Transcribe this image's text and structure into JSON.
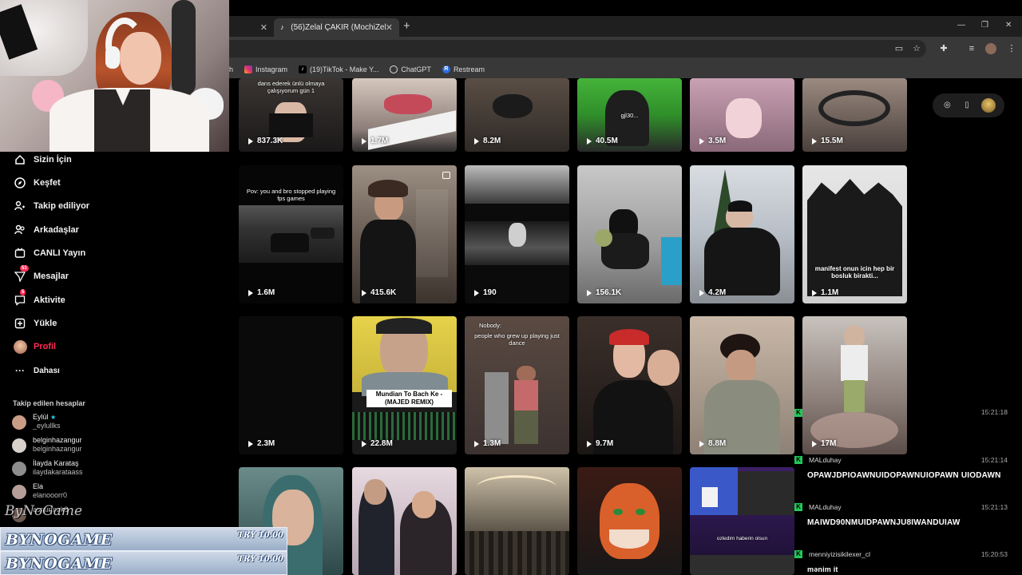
{
  "browser": {
    "tabs": [
      {
        "title": "(56)Zelal ÇAKIR (MochiZel) (@...",
        "active": true
      }
    ],
    "new_tab_label": "+",
    "bookmarks": [
      {
        "label": "h",
        "icon": "generic"
      },
      {
        "label": "Instagram",
        "icon": "instagram-icon"
      },
      {
        "label": "(19)TikTok - Make Y...",
        "icon": "tiktok-icon"
      },
      {
        "label": "ChatGPT",
        "icon": "chatgpt-icon"
      },
      {
        "label": "Restream",
        "icon": "restream-icon"
      }
    ]
  },
  "sidebar": {
    "nav": [
      {
        "label": "Sizin İçin",
        "icon": "home-icon"
      },
      {
        "label": "Keşfet",
        "icon": "compass-icon"
      },
      {
        "label": "Takip ediliyor",
        "icon": "following-icon"
      },
      {
        "label": "Arkadaşlar",
        "icon": "friends-icon"
      },
      {
        "label": "CANLI Yayın",
        "icon": "live-icon"
      },
      {
        "label": "Mesajlar",
        "icon": "messages-icon",
        "badge": "51"
      },
      {
        "label": "Aktivite",
        "icon": "activity-icon",
        "badge": "5"
      },
      {
        "label": "Yükle",
        "icon": "upload-icon"
      },
      {
        "label": "Profil",
        "icon": "avatar",
        "active": true
      },
      {
        "label": "Dahası",
        "icon": "more-icon"
      }
    ],
    "following_title": "Takip edilen hesaplar",
    "accounts": [
      {
        "name": "Eylül",
        "username": "_eylullks",
        "verified": true
      },
      {
        "name": "belginhazangur",
        "username": "belginhazangur"
      },
      {
        "name": "İlayda Karataş",
        "username": "ilaydakarataass"
      },
      {
        "name": "Ela",
        "username": "elanooorr0"
      },
      {
        "name": "",
        "username": "esrairmak8"
      }
    ]
  },
  "videos": {
    "row1": [
      "837.3K",
      "1.7M",
      "8.2M",
      "40.5M",
      "3.5M",
      "15.5M"
    ],
    "row2": [
      "1.6M",
      "415.6K",
      "190",
      "156.1K",
      "4.2M",
      "1.1M"
    ],
    "row3": [
      "2.3M",
      "22.8M",
      "1.3M",
      "9.7M",
      "8.8M",
      "17M"
    ],
    "captions": {
      "r1c1": "dans ederek ünlü olmaya çalışıyorum gün 1",
      "r1c4": "gjl30...",
      "r2c1": "Pov: you and bro stopped playing fps games",
      "r2c6": "manifest onun icin hep bir bosluk birakti...",
      "r3c2": "Mundian To Bach Ke - (MAJED REMIX)",
      "r3c3": "people who grew up playing just dance",
      "r3c3_top": "Nobody:",
      "r4c5": "ozledim haberin olsun"
    }
  },
  "chat": [
    {
      "user": "",
      "time": "15:21:18",
      "text": ""
    },
    {
      "user": "MALduhay",
      "time": "15:21:14",
      "text": "OPAWJDPIOAWNUIDOPAWNUIOPAWN UIODAWN"
    },
    {
      "user": "MALduhay",
      "time": "15:21:13",
      "text": "MAIWD90NMUIDPAWNJU8IWANDUIAW"
    },
    {
      "user": "menniyizisikilexer_cl",
      "time": "15:20:53",
      "text": "mənim it"
    }
  ],
  "donations": [
    {
      "name": "BYNOGAME",
      "amount": "TRY 10.00"
    },
    {
      "name": "BYNOGAME",
      "amount": "TRY 10.00"
    }
  ],
  "watermark": "ByNoGame",
  "colors": {
    "accent": "#fe2c55",
    "chat_badge": "#22c85a"
  }
}
